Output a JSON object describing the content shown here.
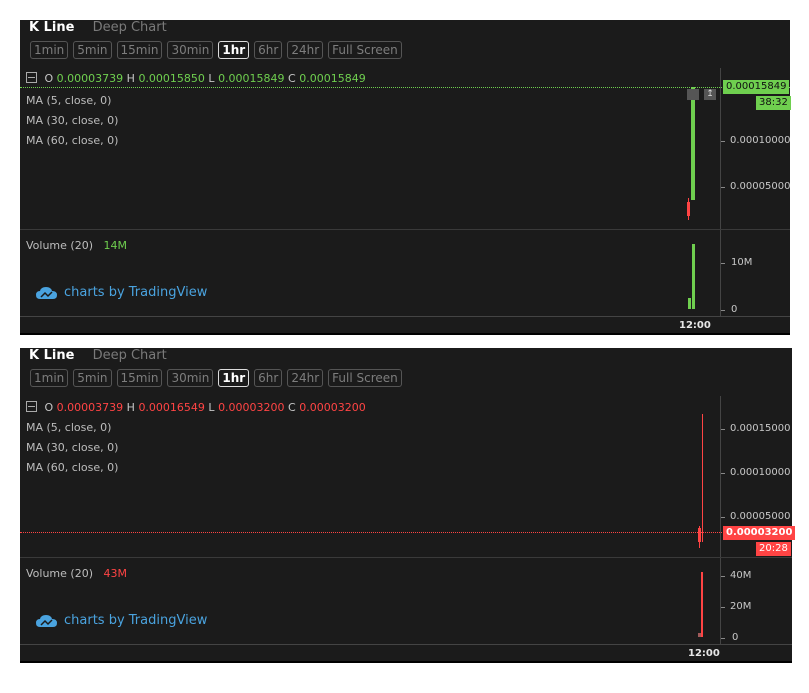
{
  "tabs": {
    "active": "K Line",
    "inactive": "Deep Chart"
  },
  "timeframes": [
    "1min",
    "5min",
    "15min",
    "30min",
    "1hr",
    "6hr",
    "24hr",
    "Full Screen"
  ],
  "selected_timeframe": "1hr",
  "ma_lines": [
    "MA (5, close, 0)",
    "MA (30, close, 0)",
    "MA (60, close, 0)"
  ],
  "volume_label": "Volume (20)",
  "watermark": "charts by TradingView",
  "time_label": "12:00",
  "colors": {
    "up": "#6fcf4f",
    "down": "#ff4444",
    "panel_bg": "#1b1b1b",
    "watermark": "#4aa3df"
  },
  "chart1": {
    "ohlc": {
      "o_label": "O",
      "o": "0.00003739",
      "h_label": "H",
      "h": "0.00015850",
      "l_label": "L",
      "l": "0.00015849",
      "c_label": "C",
      "c": "0.00015849"
    },
    "price_ticks": [
      "0.00010000",
      "0.00005000"
    ],
    "price_tag": "0.00015849",
    "countdown": "38:32",
    "volume_value": "14M",
    "volume_ticks": [
      "10M",
      "0"
    ]
  },
  "chart2": {
    "ohlc": {
      "o_label": "O",
      "o": "0.00003739",
      "h_label": "H",
      "h": "0.00016549",
      "l_label": "L",
      "l": "0.00003200",
      "c_label": "C",
      "c": "0.00003200"
    },
    "price_ticks": [
      "0.00015000",
      "0.00010000",
      "0.00005000"
    ],
    "price_tag": "0.00003200",
    "countdown": "20:28",
    "volume_value": "43M",
    "volume_ticks": [
      "40M",
      "20M",
      "0"
    ]
  }
}
